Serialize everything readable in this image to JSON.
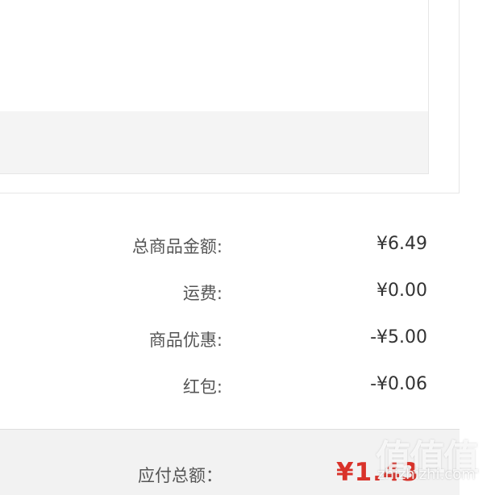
{
  "summary": {
    "rows": [
      {
        "label": "总商品金额:",
        "value": "¥6.49"
      },
      {
        "label": "运费:",
        "value": "¥0.00"
      },
      {
        "label": "商品优惠:",
        "value": "-¥5.00"
      },
      {
        "label": "红包:",
        "value": "-¥0.06"
      }
    ]
  },
  "total": {
    "label": "应付总额：",
    "value": "¥1.43"
  },
  "watermark": {
    "logo": "值值值",
    "url": "zhizhizhi.com"
  }
}
